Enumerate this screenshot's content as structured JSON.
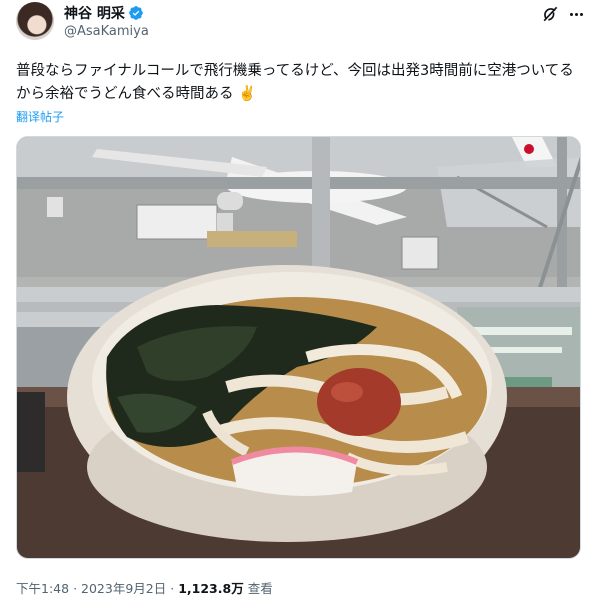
{
  "author": {
    "display_name": "神谷 明采",
    "handle": "@AsaKamiya",
    "verified": true
  },
  "tweet": {
    "text": "普段ならファイナルコールで飛行機乗ってるけど、今回は出発3時間前に空港ついてるから余裕でうどん食べる時間ある ✌️",
    "translate_label": "翻译帖子"
  },
  "meta": {
    "time": "下午1:48",
    "separator": "·",
    "date": "2023年9月2日",
    "views_count": "1,123.8万",
    "views_label": "查看"
  },
  "colors": {
    "accent": "#1d9bf0",
    "text": "#0f1419",
    "secondary": "#536471"
  },
  "icons": {
    "verified": "verified-badge-icon",
    "grok": "grok-icon",
    "more": "more-options-icon"
  }
}
